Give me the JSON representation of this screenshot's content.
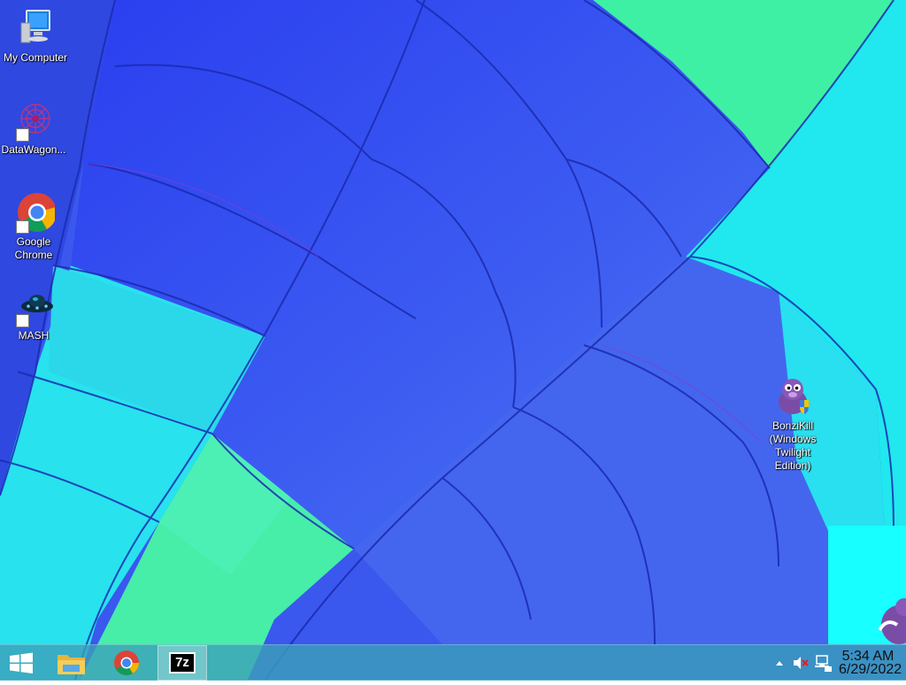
{
  "desktop": {
    "icons": [
      {
        "label": "My Computer"
      },
      {
        "label": "DataWagon..."
      },
      {
        "label": "Google Chrome"
      },
      {
        "label": "MASH"
      },
      {
        "label": "BonziKill (Windows Twilight Edition)"
      }
    ]
  },
  "taskbar": {
    "start_icon": "windows-logo-icon",
    "pinned": [
      {
        "name": "file-explorer",
        "icon": "folder-icon"
      },
      {
        "name": "google-chrome",
        "icon": "chrome-icon"
      },
      {
        "name": "7-zip",
        "icon": "7zip-icon",
        "label": "7z"
      }
    ],
    "tray": {
      "time": "5:34 AM",
      "date": "6/29/2022",
      "icons": [
        "chevron-up-icon",
        "volume-muted-icon",
        "network-icon"
      ]
    }
  },
  "colors": {
    "taskbar": "#3ca0b9",
    "panel_blue": "#3c5cf0",
    "panel_cyan": "#22e8ee",
    "panel_green": "#3ef0a0"
  }
}
